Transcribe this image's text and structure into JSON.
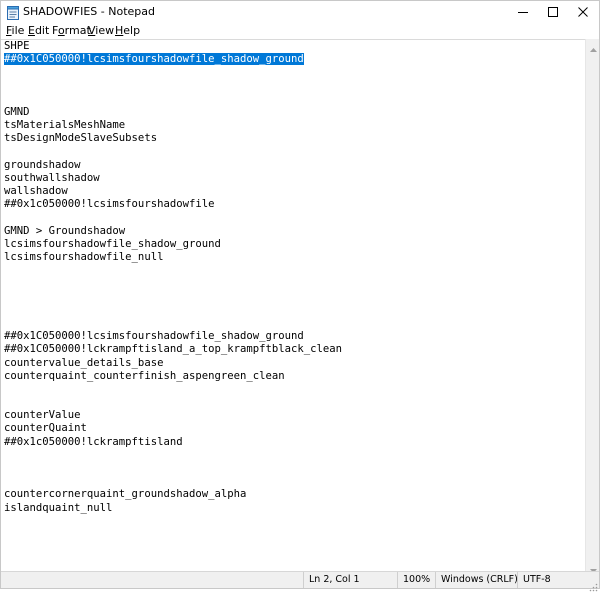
{
  "window": {
    "title": "SHADOWFIES - Notepad",
    "app_icon": "notepad-icon",
    "controls": {
      "minimize": "minimize-icon",
      "maximize": "maximize-icon",
      "close": "close-icon"
    }
  },
  "menu": [
    {
      "label_accel": "F",
      "label_rest": "ile"
    },
    {
      "label_accel": "E",
      "label_rest": "dit"
    },
    {
      "label_pre": "F",
      "label_accel": "o",
      "label_rest": "rmat"
    },
    {
      "label_accel": "V",
      "label_rest": "iew"
    },
    {
      "label_accel": "H",
      "label_rest": "elp"
    }
  ],
  "editor": {
    "lines": [
      "SHPE",
      "##0x1C050000!lcsimsfourshadowfile_shadow_ground",
      "",
      "",
      "",
      "GMND",
      "tsMaterialsMeshName",
      "tsDesignModeSlaveSubsets",
      "",
      "groundshadow",
      "southwallshadow",
      "wallshadow",
      "##0x1c050000!lcsimsfourshadowfile",
      "",
      "GMND > Groundshadow",
      "lcsimsfourshadowfile_shadow_ground",
      "lcsimsfourshadowfile_null",
      "",
      "",
      "",
      "",
      "",
      "##0x1C050000!lcsimsfourshadowfile_shadow_ground",
      "##0x1C050000!lckrampftisland_a_top_krampftblack_clean",
      "countervalue_details_base",
      "counterquaint_counterfinish_aspengreen_clean",
      "",
      "",
      "counterValue",
      "counterQuaint",
      "##0x1c050000!lckrampftisland",
      "",
      "",
      "",
      "countercornerquaint_groundshadow_alpha",
      "islandquaint_null"
    ],
    "selected_line": 1,
    "selection_color": "#0078d7"
  },
  "status": {
    "position": "Ln 2, Col 1",
    "zoom": "100%",
    "line_ending": "Windows (CRLF)",
    "encoding": "UTF-8"
  }
}
